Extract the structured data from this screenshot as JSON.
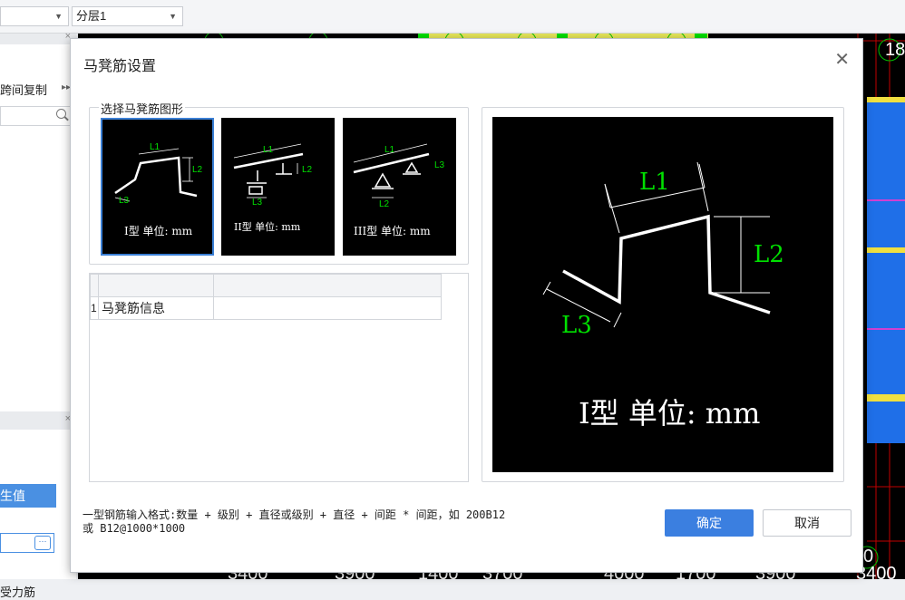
{
  "toolbar": {
    "combo1": "",
    "combo2": "分层1"
  },
  "left_panel": {
    "copy_button": "跨间复制",
    "prop_header": "生值",
    "prop_text": "受力筋"
  },
  "cad": {
    "labels": [
      "18",
      "3400",
      "3900",
      "1400",
      "3700",
      "4000",
      "1700",
      "3900",
      "3400",
      "0"
    ]
  },
  "dialog": {
    "title": "马凳筋设置",
    "group_label": "选择马凳筋图形",
    "thumbnails": [
      {
        "caption": "I型 单位: mm",
        "labels": [
          "L1",
          "L2",
          "L3"
        ]
      },
      {
        "caption": "II型 单位: mm",
        "labels": [
          "L1",
          "L2",
          "L3"
        ]
      },
      {
        "caption": "III型 单位: mm",
        "labels": [
          "L1",
          "L3",
          "L2"
        ]
      }
    ],
    "grid": {
      "rows": [
        {
          "num": "1",
          "name": "马凳筋信息",
          "value": ""
        }
      ]
    },
    "preview": {
      "caption": "I型 单位: mm",
      "labels": [
        "L1",
        "L2",
        "L3"
      ]
    },
    "hint": "一型钢筋输入格式:数量 + 级别 + 直径或级别 + 直径 + 间距 * 间距，如 200B12\n或 B12@1000*1000",
    "ok_label": "确定",
    "cancel_label": "取消"
  },
  "colors": {
    "accent": "#3b7fe0",
    "dim_green": "#00d400",
    "cad_bg": "#000000"
  }
}
